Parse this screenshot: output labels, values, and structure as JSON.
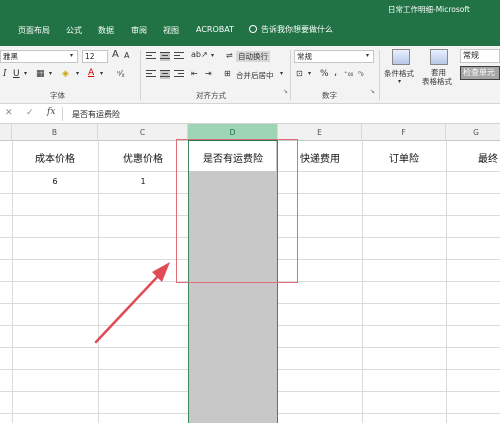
{
  "titlebar": {
    "app_title": "日常工作明细-Microsoft",
    "tabs": [
      "页面布局",
      "公式",
      "数据",
      "审阅",
      "视图",
      "ACROBAT"
    ],
    "tell_me": "告诉我你想要做什么"
  },
  "ribbon": {
    "font_name": "雅黑",
    "font_size": "12",
    "font_grow": "A",
    "font_shrink": "A",
    "italic": "I",
    "underline": "U",
    "wrap_text": "自动换行",
    "merge_center": "合并后居中",
    "number_format": "常规",
    "percent": "%",
    "comma": ",",
    "conditional_format": "条件格式",
    "format_as_table_1": "套用",
    "format_as_table_2": "表格格式",
    "style_normal": "常规",
    "style_check": "检查单元",
    "groups": {
      "font": "字体",
      "alignment": "对齐方式",
      "number": "数字"
    }
  },
  "formula_bar": {
    "cancel": "✕",
    "enter": "✓",
    "fx": "fx",
    "content": "是否有运费险"
  },
  "sheet": {
    "columns": [
      "B",
      "C",
      "D",
      "E",
      "F",
      "G"
    ],
    "selected_column": "D",
    "headers": [
      "成本价格",
      "优惠价格",
      "是否有运费险",
      "快递费用",
      "订单险",
      "最终"
    ],
    "row2": [
      "6",
      "1",
      "",
      "",
      "",
      ""
    ]
  },
  "colors": {
    "accent": "#217346",
    "selection_fill": "#c8c8c8",
    "highlight_box": "#e06d78",
    "arrow": "#e04b57"
  }
}
